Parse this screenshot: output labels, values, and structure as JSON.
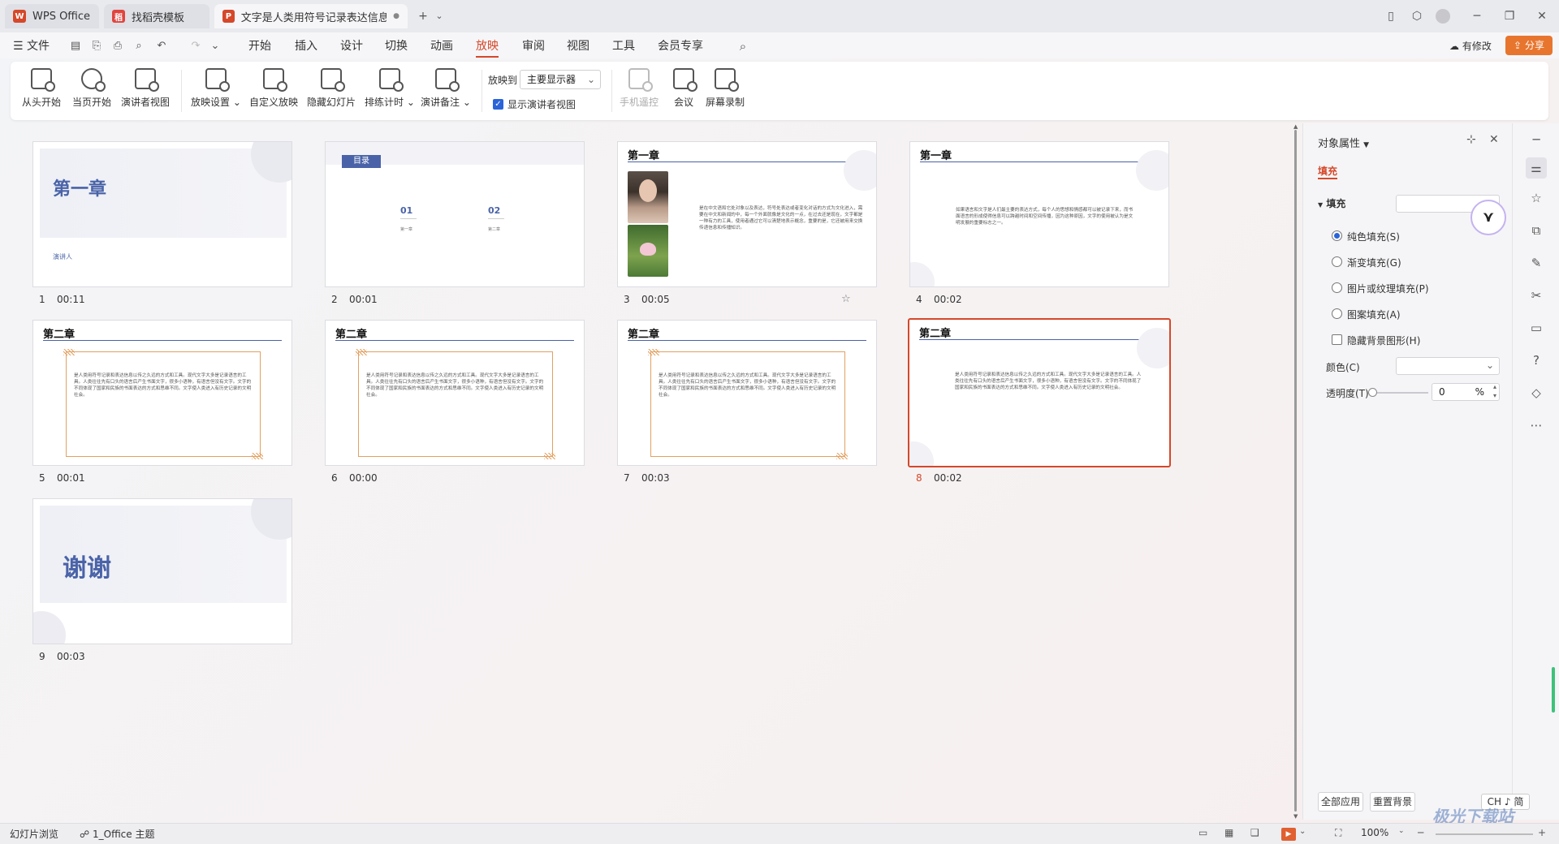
{
  "tabs": [
    {
      "label": "WPS Office",
      "icon": "wps-logo-icon"
    },
    {
      "label": "找稻壳模板",
      "icon": "docer-icon"
    },
    {
      "label": "文字是人类用符号记录表达信息以",
      "icon": "ppt-icon",
      "modified": "●"
    }
  ],
  "titlebar": {
    "new_tab": "+",
    "dropdown": "⌄"
  },
  "menu": {
    "file": "文件",
    "items": [
      "开始",
      "插入",
      "设计",
      "切换",
      "动画",
      "放映",
      "审阅",
      "视图",
      "工具",
      "会员专享"
    ],
    "active": "放映",
    "status_changes": "有修改",
    "share": "分享"
  },
  "ribbon": {
    "buttons": [
      "从头开始",
      "当页开始",
      "演讲者视图",
      "放映设置",
      "自定义放映",
      "隐藏幻灯片",
      "排练计时",
      "演讲备注"
    ],
    "play_to_label": "放映到",
    "play_to_value": "主要显示器",
    "presenter_view_checkbox": "显示演讲者视图",
    "right_buttons": [
      "手机遥控",
      "会议",
      "屏幕录制"
    ]
  },
  "slides": [
    {
      "num": "1",
      "time": "00:11",
      "title": "第一章",
      "sub": "演讲人"
    },
    {
      "num": "2",
      "time": "00:01",
      "toc": "目录",
      "items": [
        "01",
        "02"
      ],
      "item_labels": [
        "第一章",
        "第二章"
      ]
    },
    {
      "num": "3",
      "time": "00:05",
      "title": "第一章",
      "text": "是在中文语和它处对象以及表达，符号处表达或者变化对话的方式为文化进入，需要在中文和新闻的中，每一个外面就像是文化的一点，在过去还是现在，文字都是一种有力的工具，使用者通过它可以清楚地表示概念，重要的是，它还被用来交换传递信息和传播知识。"
    },
    {
      "num": "4",
      "time": "00:02",
      "title": "第一章",
      "text": "如果语言和文字是人们最主要的表达方式，每个人的思想和情感都可以被记录下来，而书面语言的形成使得信息可以跨越时间和空间传播，因为这种原因，文字的使用被认为是文明发展的重要标志之一。"
    },
    {
      "num": "5",
      "time": "00:01",
      "title": "第二章",
      "text": "是人类用符号记录和表达信息以传之久远的方式和工具。现代文字大多是记录语言的工具。人类往往先有口头的语言后产生书面文字，很多小语种，有语言但没有文字。文字的不同体现了国家和民族的书面表达的方式和思维不同。文字使人类进入有历史记录的文明社会。"
    },
    {
      "num": "6",
      "time": "00:00",
      "title": "第二章",
      "text": "是人类用符号记录和表达信息以传之久远的方式和工具。现代文字大多是记录语言的工具。人类往往先有口头的语言后产生书面文字，很多小语种，有语言但没有文字。文字的不同体现了国家和民族的书面表达的方式和思维不同。文字使人类进入有历史记录的文明社会。"
    },
    {
      "num": "7",
      "time": "00:03",
      "title": "第二章",
      "text": "是人类用符号记录和表达信息以传之久远的方式和工具。现代文字大多是记录语言的工具。人类往往先有口头的语言后产生书面文字，很多小语种，有语言但没有文字。文字的不同体现了国家和民族的书面表达的方式和思维不同。文字使人类进入有历史记录的文明社会。"
    },
    {
      "num": "8",
      "time": "00:02",
      "title": "第二章",
      "text": "是人类用符号记录和表达信息以传之久远的方式和工具。现代文字大多是记录语言的工具。人类往往先有口头的语言后产生书面文字，很多小语种，有语言但没有文字。文字的不同体现了国家和民族的书面表达的方式和思维不同。文字使人类进入有历史记录的文明社会。"
    },
    {
      "num": "9",
      "time": "00:03",
      "title": "谢谢"
    }
  ],
  "panel": {
    "title": "对象属性",
    "tab": "填充",
    "section": "填充",
    "options": [
      "纯色填充(S)",
      "渐变填充(G)",
      "图片或纹理填充(P)",
      "图案填充(A)"
    ],
    "hide_bg": "隐藏背景图形(H)",
    "color_label": "颜色(C)",
    "transparency_label": "透明度(T)",
    "transparency_value": "0",
    "percent": "%",
    "apply_all": "全部应用",
    "reset_bg": "重置背景"
  },
  "statusbar": {
    "view": "幻灯片浏览",
    "theme": "1_Office 主题",
    "zoom": "100%",
    "ime": "CH ♪ 简"
  },
  "watermark": "极光下载站",
  "colors": {
    "accent": "#d5482a",
    "title_blue": "#4a63a8",
    "frame_orange": "#e3a061"
  }
}
